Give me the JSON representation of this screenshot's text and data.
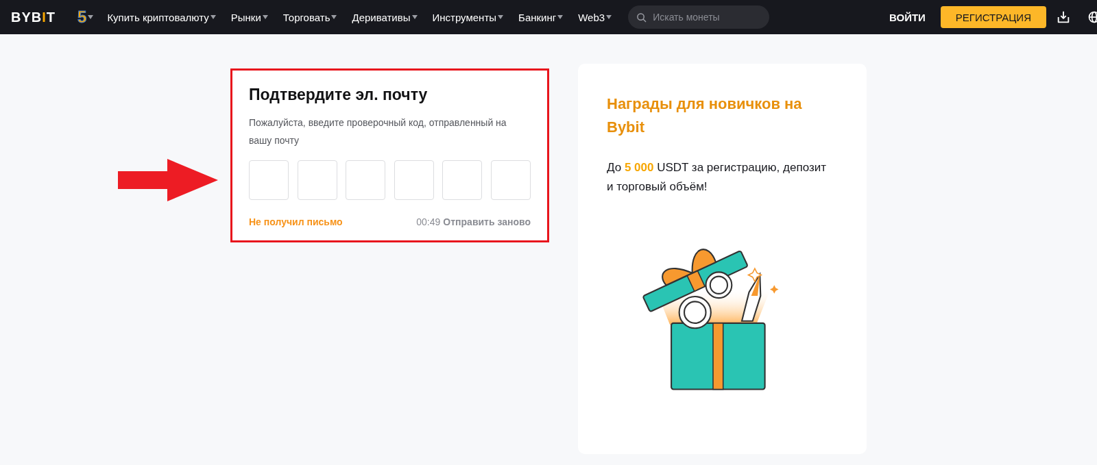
{
  "header": {
    "logo": "BYBIT",
    "badge": "5",
    "nav": [
      {
        "label": "Купить криптовалюту",
        "has_dropdown": true
      },
      {
        "label": "Рынки",
        "has_dropdown": true
      },
      {
        "label": "Торговать",
        "has_dropdown": true
      },
      {
        "label": "Деривативы",
        "has_dropdown": true
      },
      {
        "label": "Инструменты",
        "has_dropdown": true
      },
      {
        "label": "Банкинг",
        "has_dropdown": true
      },
      {
        "label": "Web3",
        "has_dropdown": true
      }
    ],
    "search": {
      "placeholder": "Искать монеты"
    },
    "login": "ВОЙТИ",
    "register": "РЕГИСТРАЦИЯ"
  },
  "verify": {
    "title": "Подтвердите эл. почту",
    "description": "Пожалуйста, введите проверочный код, отправленный на вашу почту",
    "code_fields": [
      {
        "filled": false
      },
      {
        "filled": false
      },
      {
        "filled": false
      },
      {
        "filled": false
      },
      {
        "filled": false
      },
      {
        "filled": false
      }
    ],
    "no_email_link": "Не получил письмо",
    "timer": "00:49",
    "resend": "Отправить заново",
    "highlighted": true
  },
  "promo": {
    "title": "Награды для новичков на Bybit",
    "text_before": "До",
    "amount": "5 000",
    "text_after": "USDT за регистрацию, депозит и торговый объём!"
  }
}
